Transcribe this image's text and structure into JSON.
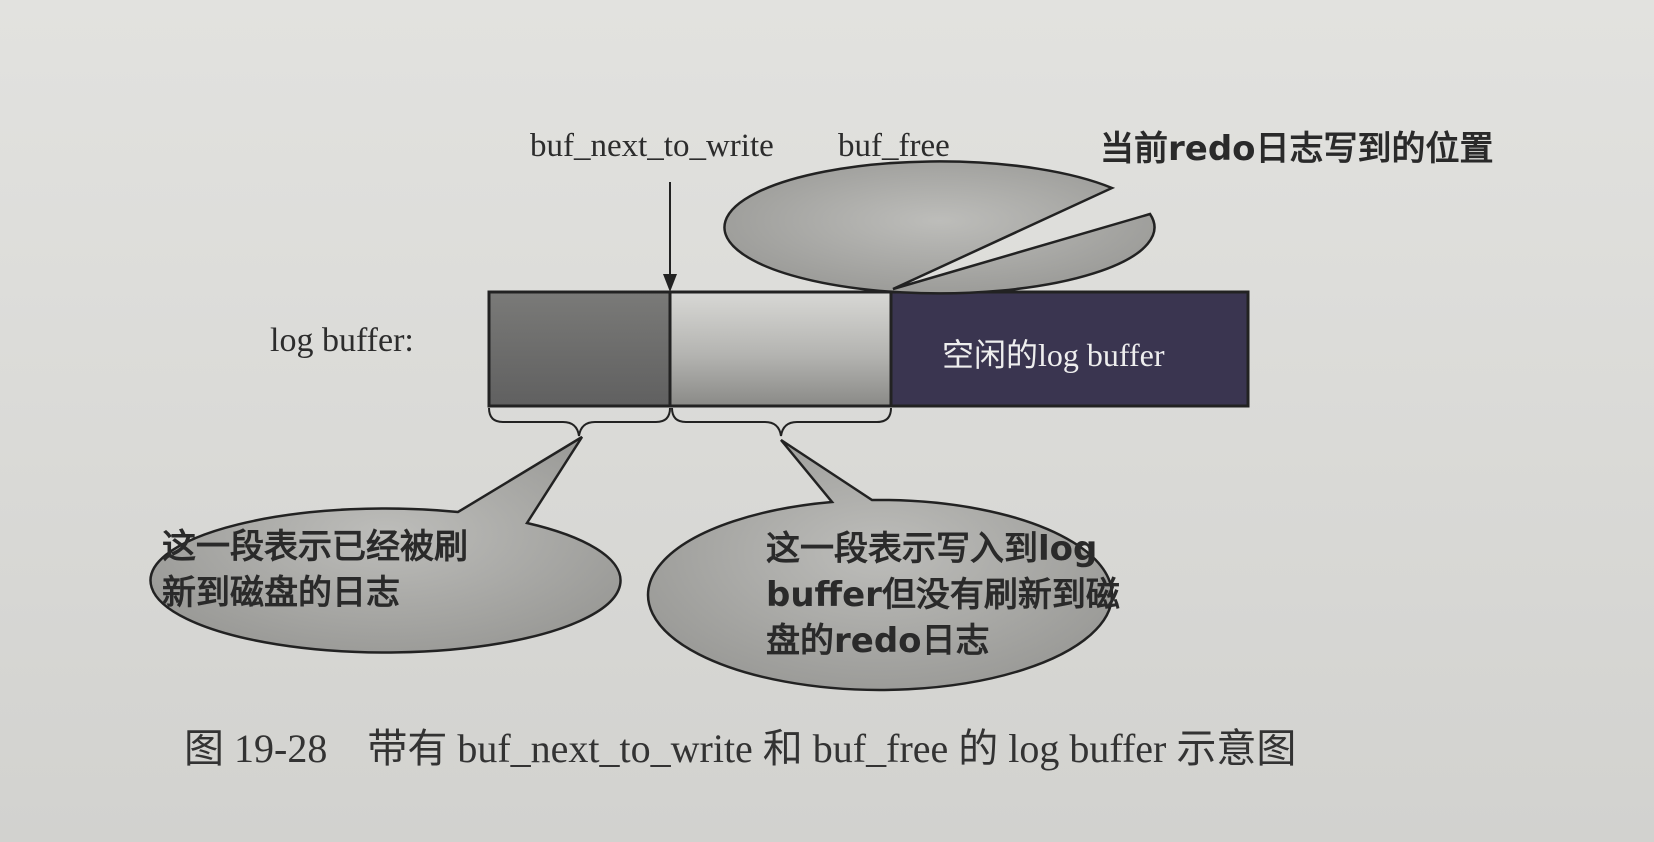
{
  "diagram": {
    "buffer_label": "log buffer:",
    "pointers": {
      "next_to_write": "buf_next_to_write",
      "free": "buf_free"
    },
    "segments": {
      "free_label": "空闲的log buffer"
    },
    "callouts": {
      "current_position": "当前redo日志写到的位置",
      "flushed": [
        "这一段表示已经被刷",
        "新到磁盘的日志"
      ],
      "unflushed": [
        "这一段表示写入到log",
        "buffer但没有刷新到磁",
        "盘的redo日志"
      ]
    },
    "caption": "图 19-28　带有 buf_next_to_write 和 buf_free 的 log buffer 示意图"
  },
  "colors": {
    "flushed_segment": "#6f6f6f",
    "unflushed_segment": "#b9b9b6",
    "free_segment": "#3a3550",
    "bubble_fill": "#a9a9a6",
    "outline": "#222222"
  }
}
